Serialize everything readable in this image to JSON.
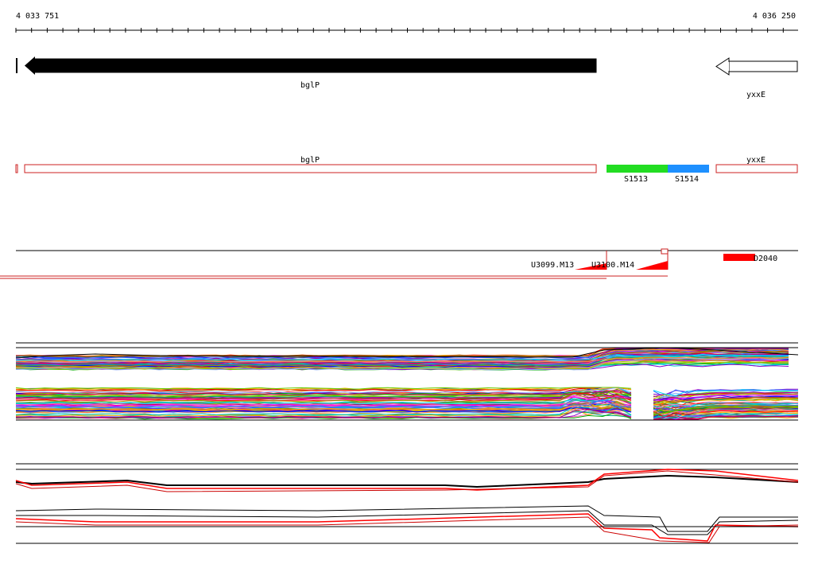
{
  "ruler": {
    "start_label": "4 033 751",
    "end_label": "4 036 250"
  },
  "genes": [
    {
      "name": "bglP",
      "strand": "-",
      "style": "filled"
    },
    {
      "name": "yxxE",
      "strand": "-",
      "style": "outline"
    }
  ],
  "transcripts": [
    {
      "name": "bglP"
    },
    {
      "name": "yxxE"
    }
  ],
  "segments": [
    {
      "name": "S1513",
      "color": "#22dd22"
    },
    {
      "name": "S1514",
      "color": "#1e90ff"
    }
  ],
  "upshifts": [
    {
      "name": "U3099.M13"
    },
    {
      "name": "U3100.M14"
    },
    {
      "name": "D2040"
    }
  ],
  "colors": {
    "gene": "#000000",
    "transcript_outline": "#cc2222",
    "feature": "#ff0000"
  },
  "profile_panels": [
    "multi-condition expression profiles",
    "selected expression profiles"
  ]
}
